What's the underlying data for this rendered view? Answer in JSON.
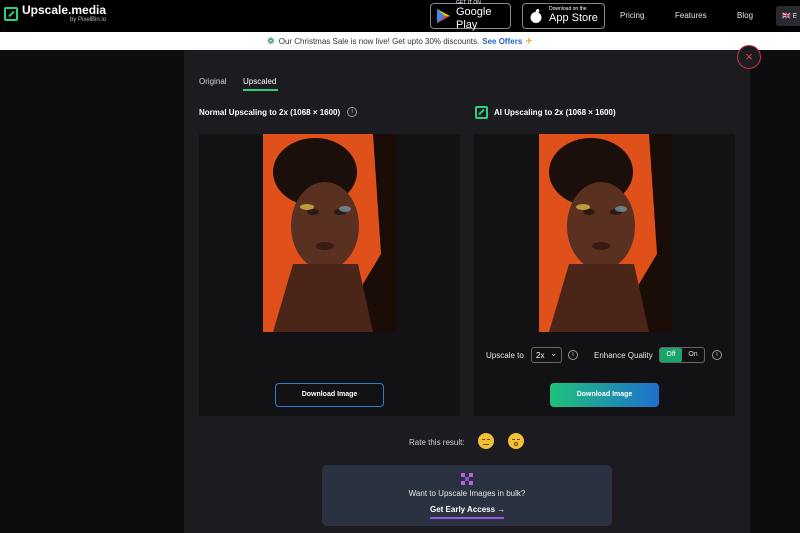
{
  "header": {
    "logo_title": "Upscale.media",
    "logo_sub": "by PixelBin.io",
    "google_play_small": "GET IT ON",
    "google_play_large": "Google Play",
    "app_store_small": "Download on the",
    "app_store_large": "App Store",
    "nav": [
      "Pricing",
      "Features",
      "Blog"
    ],
    "lang": "E"
  },
  "banner": {
    "text": "Our Christmas Sale is now live! Get upto 30% discounts.",
    "link": "See Offers"
  },
  "tabs": [
    "Original",
    "Upscaled"
  ],
  "normal": {
    "title": "Normal Upscaling to 2x (1068 × 1600)",
    "download": "Download Image"
  },
  "ai": {
    "title": "AI Upscaling to 2x (1068 × 1600)",
    "upscale_label": "Upscale to",
    "upscale_value": "2x",
    "enhance_label": "Enhance Quality",
    "toggle_off": "Off",
    "toggle_on": "On",
    "download": "Download Image"
  },
  "rate": {
    "label": "Rate this result:"
  },
  "bulk": {
    "text": "Want to Upscale Images in bulk?",
    "link": "Get Early Access →"
  },
  "close": "×",
  "colors": {
    "accent": "#2fd07a",
    "link": "#2563c9",
    "toggle_on": "#1ba56a"
  }
}
